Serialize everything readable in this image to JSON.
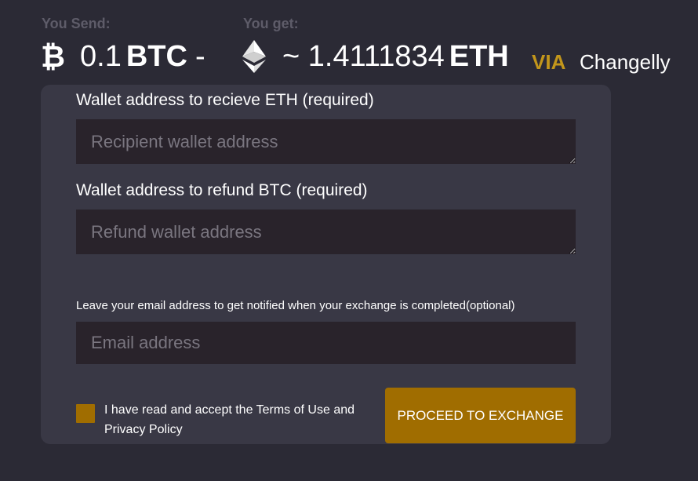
{
  "header": {
    "send_label": "You Send:",
    "get_label": "You get:",
    "send_icon": "bitcoin-icon",
    "send_amount": "0.1",
    "send_currency": "BTC",
    "separator": "-",
    "get_icon": "ethereum-icon",
    "get_amount": "~ 1.4111834",
    "get_currency": "ETH",
    "via_label": "VIA",
    "provider": "Changelly",
    "accent_color": "#c2961b"
  },
  "form": {
    "recipient_label": "Wallet address to recieve ETH (required)",
    "recipient_placeholder": "Recipient wallet address",
    "recipient_value": "",
    "refund_label": "Wallet address to refund BTC (required)",
    "refund_placeholder": "Refund wallet address",
    "refund_value": "",
    "email_label": "Leave your email address to get notified when your exchange is completed(optional)",
    "email_placeholder": "Email address",
    "email_value": "",
    "terms_text": "I have read and accept the Terms of Use and Privacy Policy",
    "terms_checked": false,
    "proceed_label": "PROCEED TO EXCHANGE",
    "button_color": "#a06d00"
  }
}
